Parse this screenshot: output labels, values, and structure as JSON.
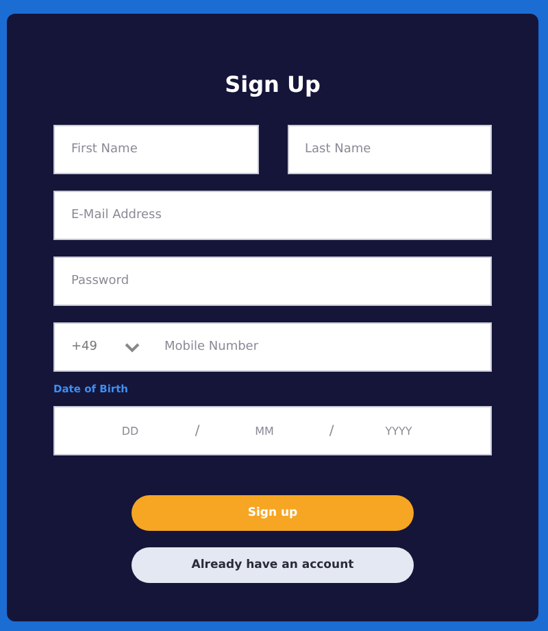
{
  "title": "Sign Up",
  "name_fields": [
    {
      "placeholder": "First Name"
    },
    {
      "placeholder": "Last Name"
    }
  ],
  "email": {
    "placeholder": "E-Mail Address"
  },
  "password": {
    "placeholder": "Password"
  },
  "phone": {
    "country_code": "+49",
    "placeholder": "Mobile Number"
  },
  "date_of_birth": {
    "label": "Date of Birth",
    "parts": [
      {
        "placeholder": "DD"
      },
      {
        "placeholder": "MM"
      },
      {
        "placeholder": "YYYY"
      }
    ],
    "separator": "/"
  },
  "buttons": [
    {
      "label": "Sign up",
      "kind": "primary"
    },
    {
      "label": "Already have an account",
      "kind": "secondary"
    }
  ]
}
